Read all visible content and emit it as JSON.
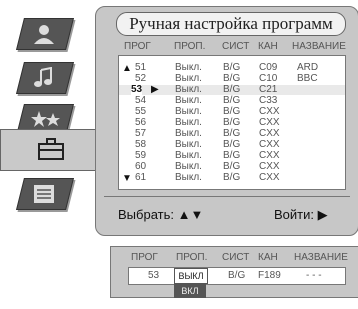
{
  "menu": {
    "title": "Ручная настройка программ",
    "icons": [
      "person-icon",
      "music-note-icon",
      "stars-icon",
      "toolbox-icon",
      "document-icon"
    ],
    "active_icon": "toolbox-icon"
  },
  "table": {
    "headers": {
      "prog": "ПРОГ",
      "skip": "ПРОП.",
      "system": "СИСТ",
      "channel": "КАН",
      "name": "НАЗВАНИЕ"
    },
    "rows": [
      {
        "prog": "51",
        "skip": "Выкл.",
        "system": "B/G",
        "channel": "C09",
        "name": "ARD"
      },
      {
        "prog": "52",
        "skip": "Выкл.",
        "system": "B/G",
        "channel": "C10",
        "name": "BBC"
      },
      {
        "prog": "53",
        "skip": "Выкл.",
        "system": "B/G",
        "channel": "C21",
        "name": ""
      },
      {
        "prog": "54",
        "skip": "Выкл.",
        "system": "B/G",
        "channel": "C33",
        "name": ""
      },
      {
        "prog": "55",
        "skip": "Выкл.",
        "system": "B/G",
        "channel": "CXX",
        "name": ""
      },
      {
        "prog": "56",
        "skip": "Выкл.",
        "system": "B/G",
        "channel": "CXX",
        "name": ""
      },
      {
        "prog": "57",
        "skip": "Выкл.",
        "system": "B/G",
        "channel": "CXX",
        "name": ""
      },
      {
        "prog": "58",
        "skip": "Выкл.",
        "system": "B/G",
        "channel": "CXX",
        "name": ""
      },
      {
        "prog": "59",
        "skip": "Выкл.",
        "system": "B/G",
        "channel": "CXX",
        "name": ""
      },
      {
        "prog": "60",
        "skip": "Выкл.",
        "system": "B/G",
        "channel": "CXX",
        "name": ""
      },
      {
        "prog": "61",
        "skip": "Выкл.",
        "system": "B/G",
        "channel": "CXX",
        "name": ""
      }
    ],
    "selected_prog": "53",
    "up_arrow": "▲",
    "down_arrow": "▼",
    "row_pointer": "▶"
  },
  "footer": {
    "select": "Выбрать: ▲▼",
    "enter": "Войти: ▶"
  },
  "detail": {
    "headers": {
      "prog": "ПРОГ",
      "skip": "ПРОП.",
      "system": "СИСТ",
      "channel": "КАН",
      "name": "НАЗВАНИЕ"
    },
    "prog": "53",
    "skip_selected": "выкл",
    "skip_alternative": "вкл",
    "system": "B/G",
    "channel": "F189",
    "name": "- - -"
  },
  "colors": {
    "panel": "#c7c7c7",
    "icon_bg": "#555555",
    "text": "#222222"
  }
}
